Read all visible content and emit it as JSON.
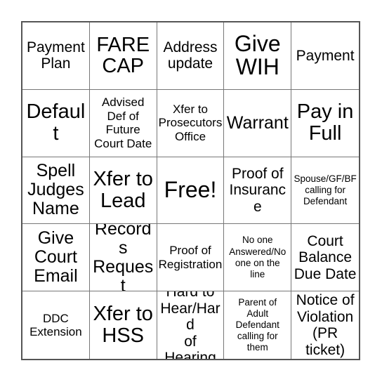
{
  "card": {
    "type": "bingo-card",
    "rows": 5,
    "columns": 5,
    "border_color": "#555555",
    "grid_line_color": "#777777",
    "background_color": "#ffffff",
    "text_color": "#000000",
    "free_space_index": 12,
    "cells": [
      {
        "text": "Payment\nPlan",
        "size": "md"
      },
      {
        "text": "FARE\nCAP",
        "size": "xl"
      },
      {
        "text": "Address\nupdate",
        "size": "md"
      },
      {
        "text": "Give\nWIH",
        "size": "xxl"
      },
      {
        "text": "Payment",
        "size": "md"
      },
      {
        "text": "Default",
        "size": "xl"
      },
      {
        "text": "Advised\nDef of\nFuture\nCourt Date",
        "size": "sm"
      },
      {
        "text": "Xfer to\nProsecutors\nOffice",
        "size": "sm"
      },
      {
        "text": "Warrant",
        "size": "lg"
      },
      {
        "text": "Pay in\nFull",
        "size": "xl"
      },
      {
        "text": "Spell\nJudges\nName",
        "size": "lg"
      },
      {
        "text": "Xfer to\nLead",
        "size": "xl"
      },
      {
        "text": "Free!",
        "size": "xxl"
      },
      {
        "text": "Proof of\nInsurance",
        "size": "md"
      },
      {
        "text": "Spouse/GF/BF\ncalling for\nDefendant",
        "size": "xs"
      },
      {
        "text": "Give\nCourt\nEmail",
        "size": "lg"
      },
      {
        "text": "Records\nRequest",
        "size": "lg"
      },
      {
        "text": "Proof of\nRegistration",
        "size": "sm"
      },
      {
        "text": "No one\nAnswered/No\none on the\nline",
        "size": "xs"
      },
      {
        "text": "Court\nBalance\nDue Date",
        "size": "md"
      },
      {
        "text": "DDC\nExtension",
        "size": "sm"
      },
      {
        "text": "Xfer to\nHSS",
        "size": "xl"
      },
      {
        "text": "Hard to\nHear/Hard\nof Hearing",
        "size": "md"
      },
      {
        "text": "Parent of\nAdult\nDefendant\ncalling for\nthem",
        "size": "xs"
      },
      {
        "text": "Notice of\nViolation\n(PR\nticket)",
        "size": "md"
      }
    ]
  }
}
